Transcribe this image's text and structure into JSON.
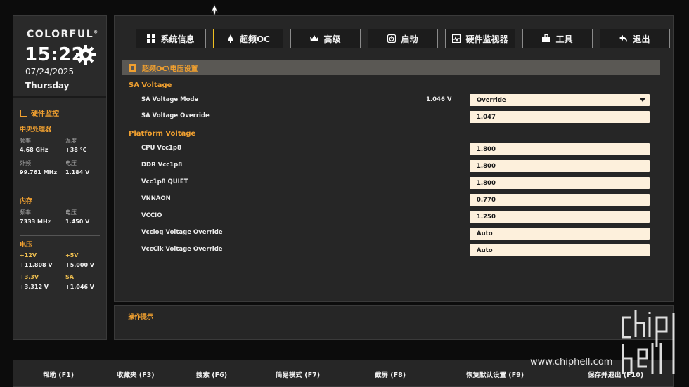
{
  "brand": {
    "name": "COLORFUL",
    "mark": "®"
  },
  "clock": {
    "time": "15:22",
    "date": "07/24/2025",
    "weekday": "Thursday"
  },
  "hardware_monitor": {
    "title": "硬件监控",
    "cpu": {
      "heading": "中央处理器",
      "freq_label": "频率",
      "freq_value": "4.68 GHz",
      "temp_label": "温度",
      "temp_value": "+38 °C",
      "ext_label": "外频",
      "ext_value": "99.761 MHz",
      "volt_label": "电压",
      "volt_value": "1.184 V"
    },
    "memory": {
      "heading": "内存",
      "freq_label": "频率",
      "freq_value": "7333 MHz",
      "volt_label": "电压",
      "volt_value": "1.450 V"
    },
    "voltage": {
      "heading": "电压",
      "v12_label": "+12V",
      "v12_value": "+11.808 V",
      "v5_label": "+5V",
      "v5_value": "+5.000 V",
      "v33_label": "+3.3V",
      "v33_value": "+3.312 V",
      "sa_label": "SA",
      "sa_value": "+1.046 V"
    }
  },
  "tabs": [
    {
      "label": "系统信息",
      "icon": "grid-icon"
    },
    {
      "label": "超频OC",
      "icon": "rocket-icon",
      "active": true
    },
    {
      "label": "高级",
      "icon": "crown-icon"
    },
    {
      "label": "启动",
      "icon": "power-icon"
    },
    {
      "label": "硬件监视器",
      "icon": "monitor-icon"
    },
    {
      "label": "工具",
      "icon": "toolbox-icon"
    },
    {
      "label": "退出",
      "icon": "back-arrow-icon"
    }
  ],
  "breadcrumb": "超频OC\\电压设置",
  "groups": {
    "sa": "SA Voltage",
    "platform": "Platform Voltage"
  },
  "settings": {
    "sa_mode": {
      "label": "SA Voltage Mode",
      "current": "1.046 V",
      "value": "Override"
    },
    "sa_override": {
      "label": "SA Voltage Override",
      "value": "1.047"
    },
    "cpu_vcc1p8": {
      "label": "CPU Vcc1p8",
      "value": "1.800"
    },
    "ddr_vcc1p8": {
      "label": "DDR Vcc1p8",
      "value": "1.800"
    },
    "vcc1p8_quiet": {
      "label": "Vcc1p8 QUIET",
      "value": "1.800"
    },
    "vnnaon": {
      "label": "VNNAON",
      "value": "0.770"
    },
    "vccio": {
      "label": "VCCIO",
      "value": "1.250"
    },
    "vcclog": {
      "label": "Vcclog Voltage Override",
      "value": "Auto"
    },
    "vccclk": {
      "label": "VccClk Voltage Override",
      "value": "Auto"
    }
  },
  "hint": {
    "title": "操作提示"
  },
  "footer": {
    "help": "帮助 (F1)",
    "favorites": "收藏夹 (F3)",
    "search": "搜索 (F6)",
    "easy_mode": "简易模式 (F7)",
    "screenshot": "截屏 (F8)",
    "defaults": "恢复默认设置 (F9)",
    "save_exit": "保存并退出 (F10)"
  },
  "watermark": {
    "url": "www.chiphell.com"
  },
  "colors": {
    "accent": "#f0a030",
    "active_tab_border": "#f0c020",
    "field_bg": "#fdf0dc",
    "panel_bg": "#262626"
  }
}
